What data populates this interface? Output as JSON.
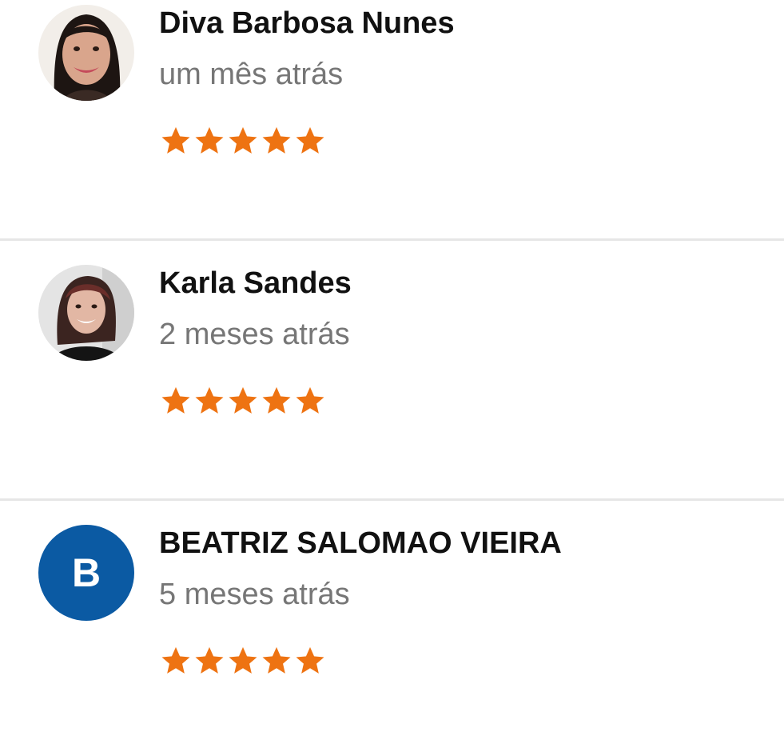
{
  "reviews": [
    {
      "name": "Diva Barbosa Nunes",
      "time": "um mês atrás",
      "rating": 5,
      "avatar": {
        "type": "photo",
        "icon": "user-photo"
      }
    },
    {
      "name": "Karla Sandes",
      "time": "2 meses atrás",
      "rating": 5,
      "avatar": {
        "type": "photo",
        "icon": "user-photo"
      }
    },
    {
      "name": "BEATRIZ SALOMAO VIEIRA",
      "time": "5 meses atrás",
      "rating": 5,
      "avatar": {
        "type": "initial",
        "letter": "B",
        "color": "#0b5aa3"
      }
    }
  ],
  "colors": {
    "star": "#ee7312",
    "name": "#111111",
    "time": "#767676",
    "divider": "#e6e6e6"
  }
}
